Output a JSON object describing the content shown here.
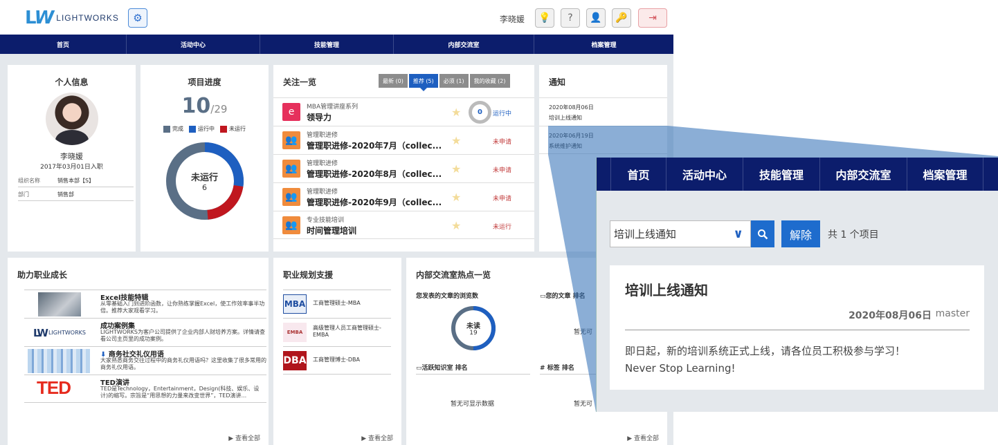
{
  "header": {
    "logo_text": "LIGHTWORKS",
    "user": "李晓媛"
  },
  "nav": [
    "首页",
    "活动中心",
    "技能管理",
    "内部交流室",
    "档案管理"
  ],
  "personal": {
    "title": "个人信息",
    "name": "李晓媛",
    "joined": "2017年03月01日入职",
    "rows": [
      {
        "k": "组织名称",
        "v": "销售本部【S】"
      },
      {
        "k": "部门",
        "v": "销售部"
      }
    ]
  },
  "progress": {
    "title": "项目进度",
    "done": "10",
    "total": "/29",
    "legend": [
      "完成",
      "运行中",
      "未运行"
    ],
    "center_label": "未运行",
    "center_value": "6"
  },
  "follow": {
    "title": "关注一览",
    "tabs": [
      "最新 (0)",
      "推荐 (5)",
      "必须 (1)",
      "我的收藏 (2)"
    ],
    "items": [
      {
        "cat": "MBA管理讲座系列",
        "title": "领导力",
        "status": "运行中",
        "progress": "0"
      },
      {
        "cat": "管理职进修",
        "title": "管理职进修-2020年7月（collec...",
        "status": "未申请"
      },
      {
        "cat": "管理职进修",
        "title": "管理职进修-2020年8月（collec...",
        "status": "未申请"
      },
      {
        "cat": "管理职进修",
        "title": "管理职进修-2020年9月（collec...",
        "status": "未申请"
      },
      {
        "cat": "专业技能培训",
        "title": "时间管理培训",
        "status": "未运行"
      }
    ]
  },
  "notice": {
    "title": "通知",
    "items": [
      {
        "date": "2020年08月06日",
        "text": "培训上线通知"
      },
      {
        "date": "2020年06月19日",
        "text": "系统维护通知"
      }
    ]
  },
  "career": {
    "title": "助力职业成长",
    "items": [
      {
        "title": "Excel技能特辑",
        "desc": "从零基础入门到进阶函数，让你熟练掌握Excel，使工作效率事半功倍。推荐大家观看学习。"
      },
      {
        "title": "成功案例集",
        "desc": "LIGHTWORKS为客户公司提供了企业内部人财培养方案。详情请查看公司主页里的成功案例。"
      },
      {
        "title": "商务社交礼仪用语",
        "desc": "大家熟悉商务交往过程中的商务礼仪用语吗？这里收集了很多常用的商务礼仪用语。"
      },
      {
        "title": "TED演讲",
        "desc": "TED是Technology，Entertainment，Design(科技、娱乐、设计)的缩写。宗旨是“用思想的力量来改变世界”，TED演讲..."
      }
    ],
    "more": "▶ 查看全部"
  },
  "planning": {
    "title": "职业规划支援",
    "items": [
      {
        "logo": "MBA",
        "text": "工商管理硕士-MBA"
      },
      {
        "logo": "EMBA",
        "text": "高级管理人员工商管理硕士-EMBA"
      },
      {
        "logo": "DBA",
        "text": "工商管理博士-DBA"
      }
    ],
    "more": "▶ 查看全部"
  },
  "hot": {
    "title": "内部交流室热点一览",
    "views_label": "您发表的文章的浏览数",
    "unread": "未读",
    "unread_count": "19",
    "my_articles": "您的文章 排名",
    "active": "活跃知识室 排名",
    "tags": "标签 排名",
    "nodata": "暂无可显示数据",
    "nodata_short": "暂无可",
    "more": "▶ 查看全部"
  },
  "zoom": {
    "nav": [
      "首页",
      "活动中心",
      "技能管理",
      "内部交流室",
      "档案管理"
    ],
    "select_value": "培训上线通知",
    "clear": "解除",
    "count": "共 1 个项目",
    "card": {
      "title": "培训上线通知",
      "date": "2020年08月06日",
      "author": "master",
      "body1": "即日起，新的培训系统正式上线，请各位员工积极参与学习！",
      "body2": "Never Stop Learning!"
    }
  },
  "colors": {
    "nav": "#0c1d6c",
    "done": "#5a6f86",
    "running": "#1e5fc0",
    "not_running": "#c0171f"
  }
}
